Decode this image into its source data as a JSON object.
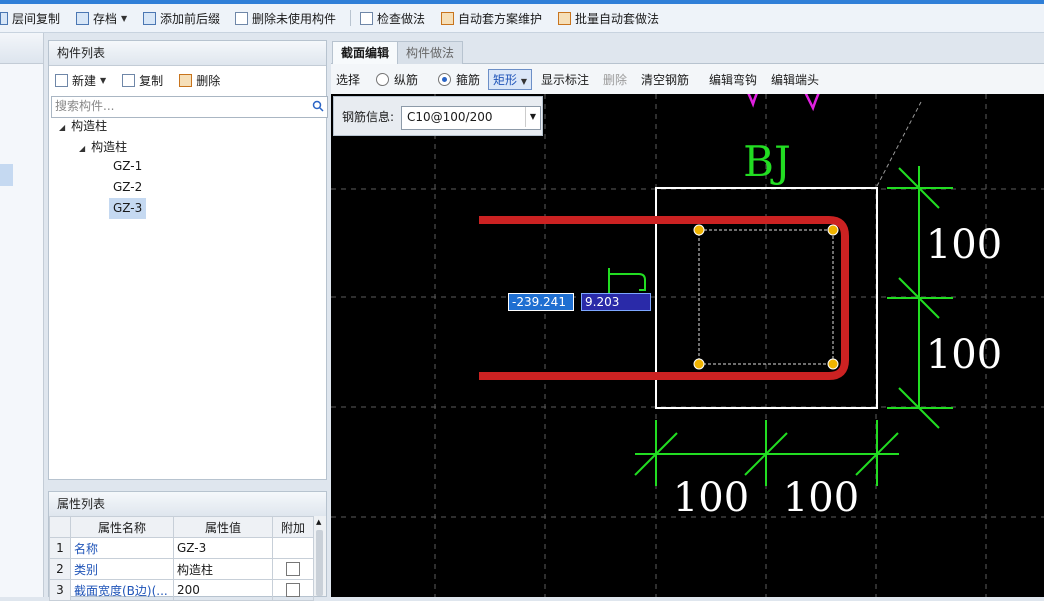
{
  "toolbar": {
    "items": [
      {
        "label": "层间复制"
      },
      {
        "label": "存档"
      },
      {
        "label": "添加前后缀"
      },
      {
        "label": "删除未使用构件"
      },
      {
        "label": "检查做法"
      },
      {
        "label": "自动套方案维护"
      },
      {
        "label": "批量自动套做法"
      }
    ]
  },
  "component_list": {
    "title": "构件列表",
    "new_label": "新建",
    "copy_label": "复制",
    "delete_label": "删除",
    "search_placeholder": "搜索构件...",
    "tree": {
      "root": "构造柱",
      "child": "构造柱",
      "items": [
        "GZ-1",
        "GZ-2",
        "GZ-3"
      ],
      "selected": "GZ-3"
    }
  },
  "property_list": {
    "title": "属性列表",
    "headers": {
      "name": "属性名称",
      "value": "属性值",
      "extra": "附加"
    },
    "rows": [
      {
        "num": "1",
        "name": "名称",
        "value": "GZ-3"
      },
      {
        "num": "2",
        "name": "类别",
        "value": "构造柱"
      },
      {
        "num": "3",
        "name": "截面宽度(B边)(...",
        "value": "200"
      }
    ]
  },
  "editor": {
    "tabs": [
      "截面编辑",
      "构件做法"
    ],
    "active_tab": "截面编辑",
    "select_label": "选择",
    "radio_longitudinal": "纵筋",
    "radio_stirrup": "箍筋",
    "shape_value": "矩形",
    "show_annotation": "显示标注",
    "delete_label": "删除",
    "clear_rebar": "清空钢筋",
    "edit_hook": "编辑弯钩",
    "edit_end": "编辑端头"
  },
  "canvas": {
    "rebar_info_label": "钢筋信息:",
    "rebar_info_value": "C10@100/200",
    "section_name": "BJ",
    "dim_right_top": "100",
    "dim_right_bottom": "100",
    "dim_bottom_left": "100",
    "dim_bottom_right": "100",
    "coord_x": "-239.241",
    "coord_y": "9.203"
  },
  "colors": {
    "canvas_bg": "#000000",
    "stirrup": "#cc2222",
    "dimension": "#22dd22",
    "section_outline": "#ffffff",
    "annotation_marks": "#e020e0",
    "rebar_points": "#f0b400"
  }
}
